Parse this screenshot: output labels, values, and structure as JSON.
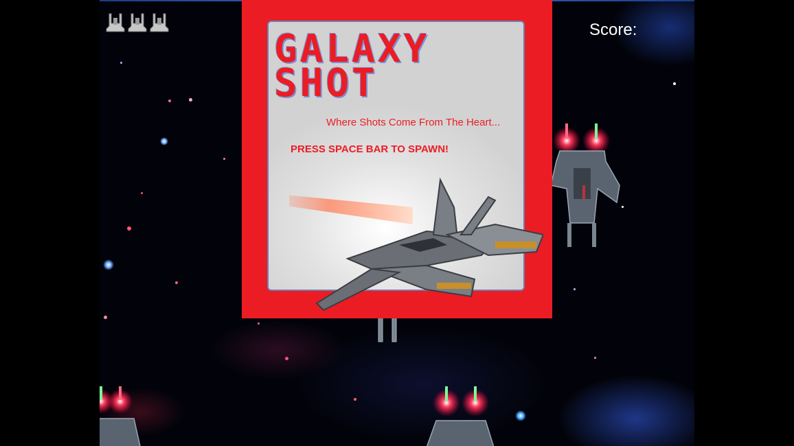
{
  "hud": {
    "score_label": "Score:",
    "lives_count": 3
  },
  "splash": {
    "title_line1": "GALAXY",
    "title_line2": "SHOT",
    "tagline": "Where Shots Come From The Heart...",
    "prompt": "PRESS SPACE BAR TO SPAWN!"
  },
  "colors": {
    "splash_red": "#ec1c24",
    "card_bg": "#d8d8d8",
    "card_border": "#6a7fb3",
    "score_text": "#ffffff",
    "space_bg": "#02030a"
  },
  "icons": {
    "lives": "fighter-ship-icon",
    "enemy": "enemy-ship-icon",
    "hero": "hero-fighter-icon"
  }
}
